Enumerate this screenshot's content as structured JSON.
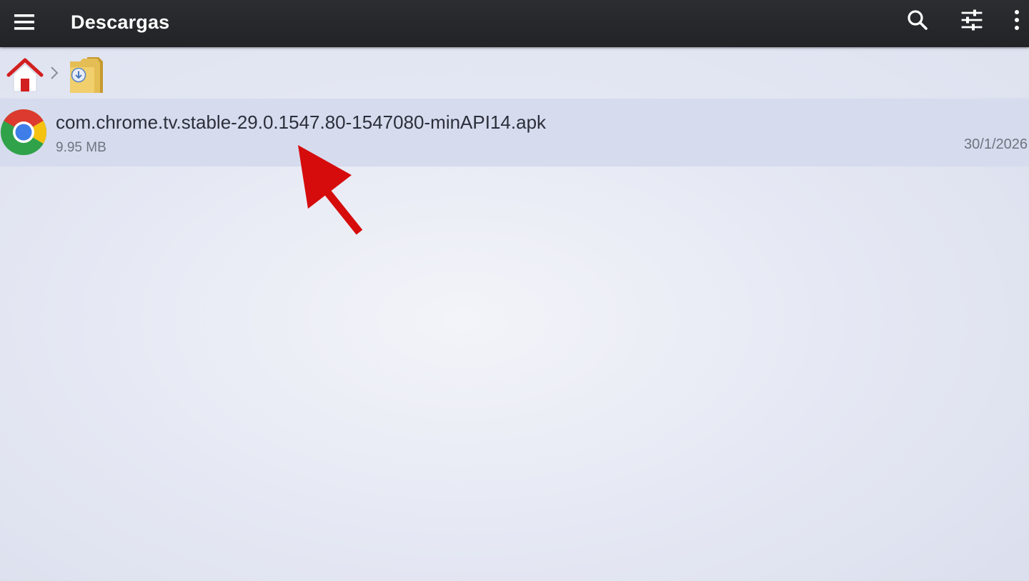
{
  "app_bar": {
    "title": "Descargas",
    "icons": {
      "menu": "hamburger-menu-icon",
      "search": "search-icon",
      "filter": "sliders-filter-icon",
      "more": "more-vert-icon"
    }
  },
  "breadcrumb": {
    "items": [
      {
        "icon": "home-icon"
      },
      {
        "icon": "downloads-folder-icon"
      }
    ]
  },
  "files": [
    {
      "name": "com.chrome.tv.stable-29.0.1547.80-1547080-minAPI14.apk",
      "size": "9.95 MB",
      "date": "30/1/2026",
      "icon": "chrome-icon"
    }
  ],
  "colors": {
    "app_bar": "#2c2d31",
    "selected_row": "#d6dbee",
    "annotation_arrow": "#d60c0c"
  }
}
